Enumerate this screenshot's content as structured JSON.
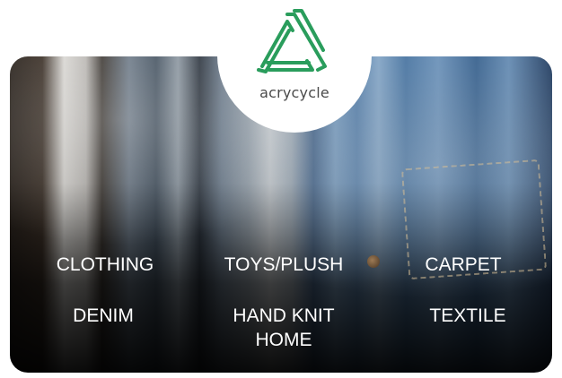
{
  "brand": {
    "name": "acrycycle",
    "accent_color": "#2a9d5c",
    "logo_icon": "recycle-triangle-icon"
  },
  "hero": {
    "background_image": "denim-jeans-closeup-photo"
  },
  "categories": [
    {
      "label": "CLOTHING"
    },
    {
      "label": "TOYS/PLUSH"
    },
    {
      "label": "CARPET"
    },
    {
      "label": "DENIM"
    },
    {
      "label": "HAND KNIT\nHOME"
    },
    {
      "label": "TEXTILE"
    }
  ]
}
